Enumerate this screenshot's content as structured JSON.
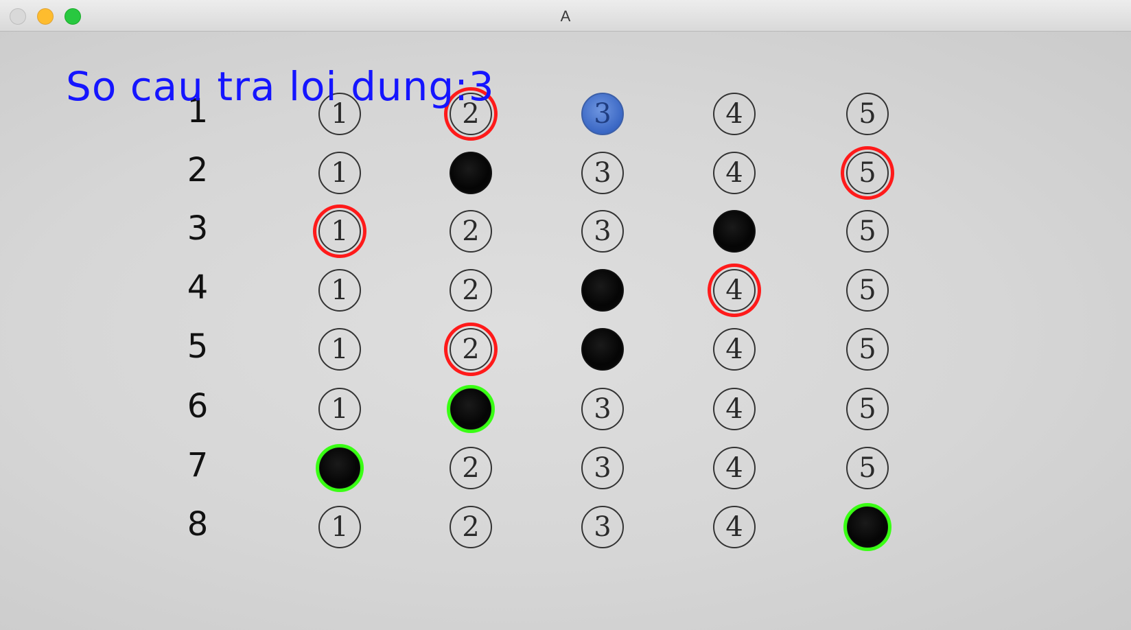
{
  "window": {
    "title": "A"
  },
  "result": {
    "score_text": "So cau tra loi dung:3"
  },
  "colors": {
    "wrong_mark": "#ff1a1a",
    "correct_mark": "#39ff14",
    "score_text": "#1515ff"
  },
  "questions": [
    {
      "number": "1",
      "options": [
        "1",
        "2",
        "3",
        "4",
        "5"
      ],
      "filled": "3",
      "filled_style": "blue",
      "marked": "2",
      "mark": "wrong"
    },
    {
      "number": "2",
      "options": [
        "1",
        "2",
        "3",
        "4",
        "5"
      ],
      "filled": "2",
      "marked": "5",
      "mark": "wrong"
    },
    {
      "number": "3",
      "options": [
        "1",
        "2",
        "3",
        "4",
        "5"
      ],
      "filled": "4",
      "marked": "1",
      "mark": "wrong"
    },
    {
      "number": "4",
      "options": [
        "1",
        "2",
        "3",
        "4",
        "5"
      ],
      "filled": "3",
      "marked": "4",
      "mark": "wrong"
    },
    {
      "number": "5",
      "options": [
        "1",
        "2",
        "3",
        "4",
        "5"
      ],
      "filled": "3",
      "marked": "2",
      "mark": "wrong"
    },
    {
      "number": "6",
      "options": [
        "1",
        "2",
        "3",
        "4",
        "5"
      ],
      "filled": "2",
      "marked": "2",
      "mark": "correct"
    },
    {
      "number": "7",
      "options": [
        "1",
        "2",
        "3",
        "4",
        "5"
      ],
      "filled": "1",
      "marked": "1",
      "mark": "correct"
    },
    {
      "number": "8",
      "options": [
        "1",
        "2",
        "3",
        "4",
        "5"
      ],
      "filled": "5",
      "marked": "5",
      "mark": "correct"
    }
  ]
}
